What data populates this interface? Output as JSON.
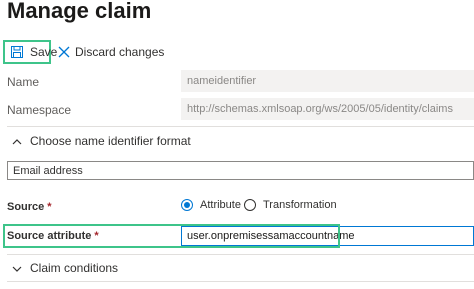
{
  "page": {
    "title": "Manage claim"
  },
  "toolbar": {
    "save_label": "Save",
    "discard_label": "Discard changes"
  },
  "fields": {
    "name_label": "Name",
    "name_value": "nameidentifier",
    "namespace_label": "Namespace",
    "namespace_value": "http://schemas.xmlsoap.org/ws/2005/05/identity/claims"
  },
  "name_id_format": {
    "header": "Choose name identifier format",
    "selected": "Email address"
  },
  "source": {
    "label": "Source",
    "required_mark": "*",
    "options": [
      {
        "label": "Attribute",
        "selected": true
      },
      {
        "label": "Transformation",
        "selected": false
      }
    ]
  },
  "source_attribute": {
    "label": "Source attribute",
    "required_mark": "*",
    "value": "user.onpremisessamaccountname"
  },
  "claim_conditions": {
    "header": "Claim conditions"
  },
  "colors": {
    "highlight": "#3ec48a",
    "accent": "#0078d4",
    "required": "#a4262c"
  }
}
